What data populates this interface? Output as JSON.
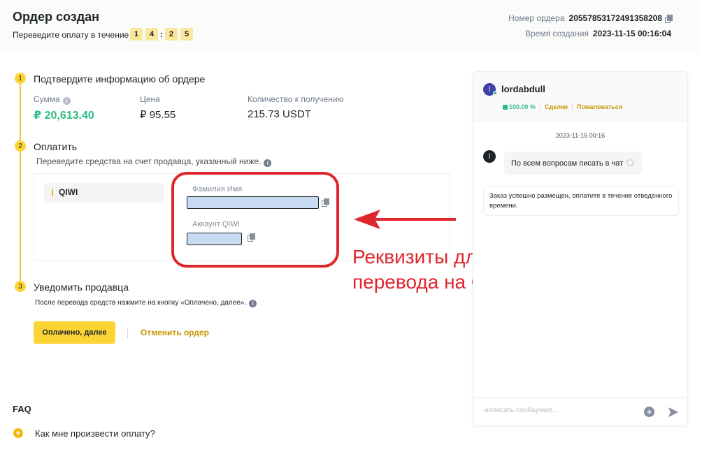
{
  "header": {
    "title": "Ордер создан",
    "timer_label": "Переведите оплату в течение",
    "timer_digits": [
      "1",
      "4",
      "2",
      "5"
    ],
    "timer_separator": ":",
    "order_number_label": "Номер ордера",
    "order_number": "20557853172491358208",
    "created_label": "Время создания",
    "created_value": "2023-11-15 00:16:04"
  },
  "steps": [
    {
      "num": "1",
      "title": "Подтвердите информацию об ордере"
    },
    {
      "num": "2",
      "title": "Оплатить"
    },
    {
      "num": "3",
      "title": "Уведомить продавца"
    }
  ],
  "order": {
    "sum_label": "Сумма",
    "sum_value": "₽ 20,613.40",
    "price_label": "Цена",
    "price_value": "₽ 95.55",
    "qty_label": "Количество к получению",
    "qty_value": "215.73 USDT"
  },
  "payment": {
    "instruction": "Переведите средства на счет продавца, указанный ниже.",
    "method": "QIWI",
    "name_label": "Фамилия Имя",
    "account_label": "Аккаунт QIWI"
  },
  "annotation": {
    "text": "Реквизиты для перевода на QIWI",
    "color": "#e0262d"
  },
  "notify": {
    "instruction": "После перевода средств нажмите на кнопку «Оплачено, далее».",
    "paid_button": "Оплачено, далее",
    "cancel_link": "Отменить ордер"
  },
  "faq": {
    "title": "FAQ",
    "question": "Как мне произвести оплату?"
  },
  "chat": {
    "seller_initial": "l",
    "seller_name": "lordabdull",
    "rating": "100.00 %",
    "deals_link": "Сделки",
    "complain_link": "Пожаловаться",
    "date": "2023-11-15 00:16",
    "seller_message": "По всем вопросам писать в чат",
    "system_message": "Заказ успешно размещен, оплатите в течение отведенного времени.",
    "input_placeholder": "написать сообщение..."
  },
  "colors": {
    "accent_yellow": "#fcd535",
    "link_gold": "#c99400",
    "positive_green": "#2ebd85"
  }
}
